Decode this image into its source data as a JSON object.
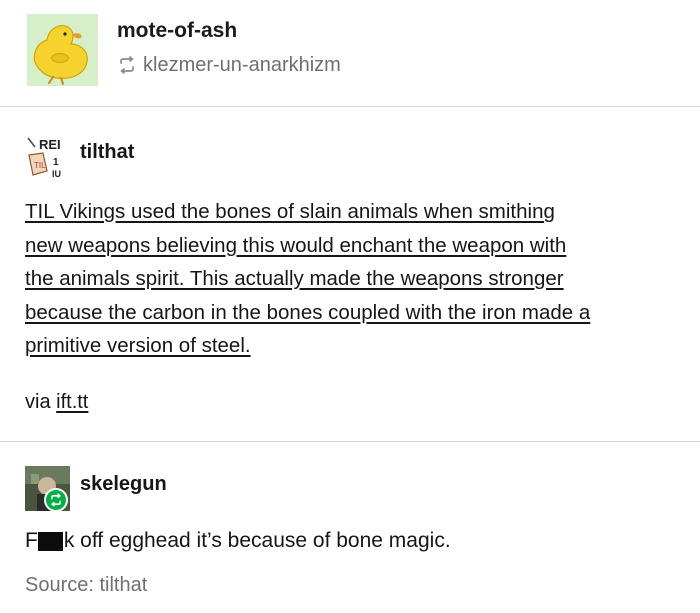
{
  "post": {
    "author": "mote-of-ash",
    "reblogged_from": "klezmer-un-anarkhizm"
  },
  "reblog_1": {
    "username": "tilthat",
    "text_lines": [
      "TIL Vikings used the bones of slain animals when smithing",
      "new weapons believing this would enchant the weapon with",
      "the animals spirit. This actually made the weapons stronger",
      "because the carbon in the bones coupled with the iron made a",
      "primitive version of steel."
    ],
    "via_prefix": "via",
    "via_link": "ift.tt"
  },
  "reblog_2": {
    "username": "skelegun",
    "comment_initial": "F",
    "comment_rest": "k off egghead it’s because of bone magic.",
    "source_label": "Source: tilthat"
  },
  "icons": {
    "avatar_main": "yellow-duck-avatar",
    "avatar_tilthat": "til-logo-avatar",
    "avatar_skelegun": "skelegun-avatar",
    "reblog": "reblog-icon",
    "reblog_badge": "reblog-badge-icon"
  },
  "colors": {
    "avatar_bg": "#d7efc9",
    "reblog_green": "#00b043",
    "muted_text": "#707070"
  }
}
